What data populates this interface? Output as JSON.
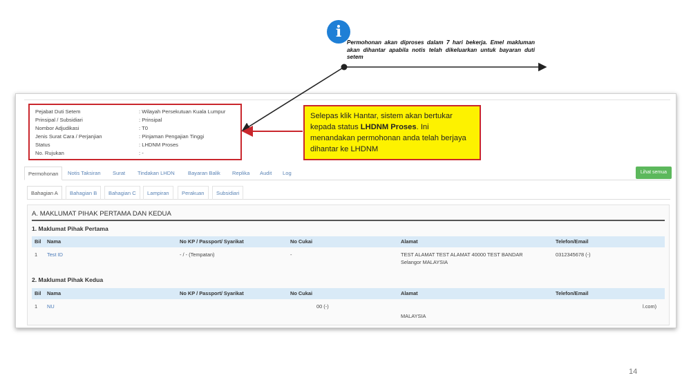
{
  "note": {
    "icon": "info-icon",
    "text": "Permohonan akan diproses dalam 7 hari bekerja. Emel makluman akan dihantar apabila notis telah dikeluarkan untuk bayaran duti setem"
  },
  "summary": {
    "rows": [
      {
        "label": "Pejabat Duti Setem",
        "value": ": Wilayah Persekutuan Kuala Lumpur"
      },
      {
        "label": "Prinsipal / Subsidiari",
        "value": ": Prinsipal"
      },
      {
        "label": "Nombor Adjudikasi",
        "value": ": T0"
      },
      {
        "label": "Jenis Surat Cara / Perjanjian",
        "value": ": Pinjaman Pengajian Tinggi"
      },
      {
        "label": "Status",
        "value": ": LHDNM Proses"
      },
      {
        "label": "No. Rujukan",
        "value": ": -"
      }
    ]
  },
  "callout": {
    "text_before": "Selepas klik Hantar, sistem akan bertukar kepada status ",
    "text_bold": "LHDNM Proses",
    "text_after": ". Ini menandakan permohonan anda telah berjaya dihantar ke LHDNM"
  },
  "tabs": [
    "Permohonan",
    "Notis Taksiran",
    "Surat",
    "Tindakan LHDN",
    "Bayaran Balik",
    "Replika",
    "Audit",
    "Log"
  ],
  "lihat_semua": "Lihat semua",
  "subtabs": [
    "Bahagian A",
    "Bahagian B",
    "Bahagian C",
    "Lampiran",
    "Perakuan",
    "Subsidiari"
  ],
  "section": {
    "title": "A. MAKLUMAT PIHAK PERTAMA DAN KEDUA",
    "columns": [
      "Bil",
      "Nama",
      "No KP / Passport/ Syarikat",
      "No Cukai",
      "Alamat",
      "Telefon/Email"
    ],
    "party1": {
      "title": "1. Maklumat Pihak Pertama",
      "row": {
        "bil": "1",
        "nama": "Test ID",
        "kp": "- / - (Tempatan)",
        "cukai": "-",
        "alamat1": "TEST ALAMAT TEST ALAMAT 40000 TEST BANDAR",
        "alamat2": "Selangor MALAYSIA",
        "telefon": "0312345678 (-)"
      }
    },
    "party2": {
      "title": "2. Maklumat Pihak Kedua",
      "row": {
        "bil": "1",
        "nama": "NU",
        "cukai": "00 (-)",
        "alamat": "MALAYSIA",
        "telefon": "l.com)"
      }
    }
  },
  "page_number": "14",
  "colors": {
    "accent_blue": "#1e7fd6",
    "callout_yellow": "#fdf200",
    "highlight_red": "#c9262c",
    "button_green": "#5cb85c",
    "table_header": "#d9eaf7"
  }
}
